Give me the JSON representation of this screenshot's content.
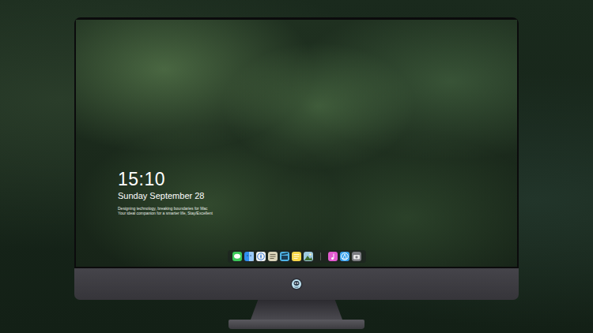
{
  "desktop": {
    "clock": "15:10",
    "date": "Sunday September 28",
    "tagline": [
      "Designing technology, breaking boundaries for Mac",
      "Your ideal companion for a smarter life, Stay/Excellent"
    ]
  }
}
